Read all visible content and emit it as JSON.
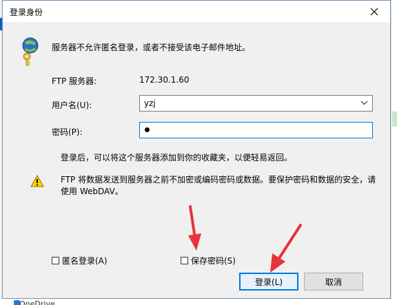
{
  "window": {
    "title": "登录身份"
  },
  "message": "服务器不允许匿名登录，或者不接受该电子邮件地址。",
  "ftp_server": {
    "label": "FTP 服务器:",
    "value": "172.30.1.60"
  },
  "username": {
    "label": "用户名(U):",
    "value": "yzj"
  },
  "password": {
    "label": "密码(P):",
    "value": "•"
  },
  "note": "登录后，可以将这个服务器添加到你的收藏夹，以便轻易返回。",
  "warning": "FTP 将数据发送到服务器之前不加密或编码密码或数据。要保护密码和数据的安全，请使用 WebDAV。",
  "checkboxes": {
    "anonymous": {
      "label": "匿名登录(A)",
      "checked": false
    },
    "save_password": {
      "label": "保存密码(S)",
      "checked": false
    }
  },
  "buttons": {
    "login": "登录(L)",
    "cancel": "取消"
  },
  "background": {
    "bottom_text": "OneDrive"
  },
  "colors": {
    "accent": "#0078d7",
    "annotation_arrow": "#e8323c",
    "warning_yellow": "#ffd400"
  },
  "icons": {
    "key": "key-icon",
    "warning": "warning-icon",
    "close": "close-icon",
    "dropdown": "chevron-down-icon"
  }
}
